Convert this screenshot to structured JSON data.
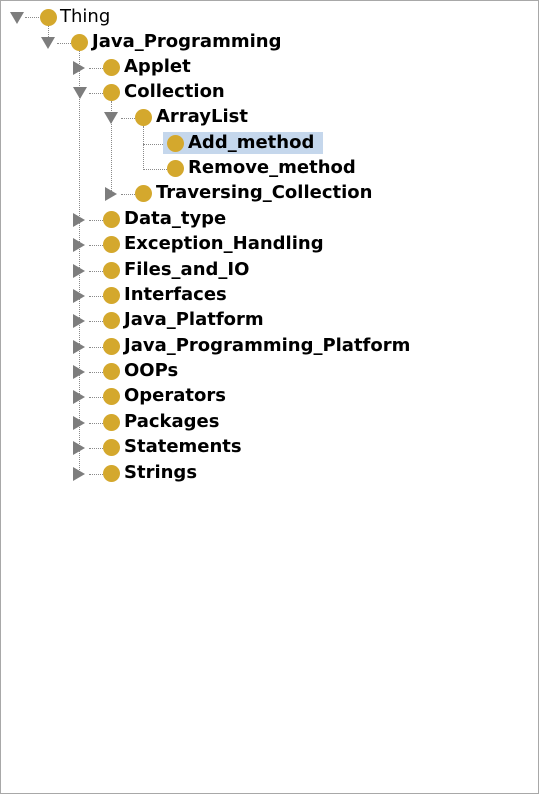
{
  "tree": {
    "root": "Thing",
    "java_programming": "Java_Programming",
    "applet": "Applet",
    "collection": "Collection",
    "arraylist": "ArrayList",
    "add_method": "Add_method",
    "remove_method": "Remove_method",
    "traversing_collection": "Traversing_Collection",
    "data_type": "Data_type",
    "exception_handling": "Exception_Handling",
    "files_and_io": "Files_and_IO",
    "interfaces": "Interfaces",
    "java_platform": "Java_Platform",
    "java_programming_platform": "Java_Programming_Platform",
    "oops": "OOPs",
    "operators": "Operators",
    "packages": "Packages",
    "statements": "Statements",
    "strings": "Strings"
  },
  "colors": {
    "node_dot": "#d4a82d",
    "selection": "#c5d7ec",
    "toggle": "#7d7d7d"
  },
  "icons": {
    "expanded": "triangle-down-icon",
    "collapsed": "triangle-right-icon",
    "class": "class-dot-icon"
  }
}
